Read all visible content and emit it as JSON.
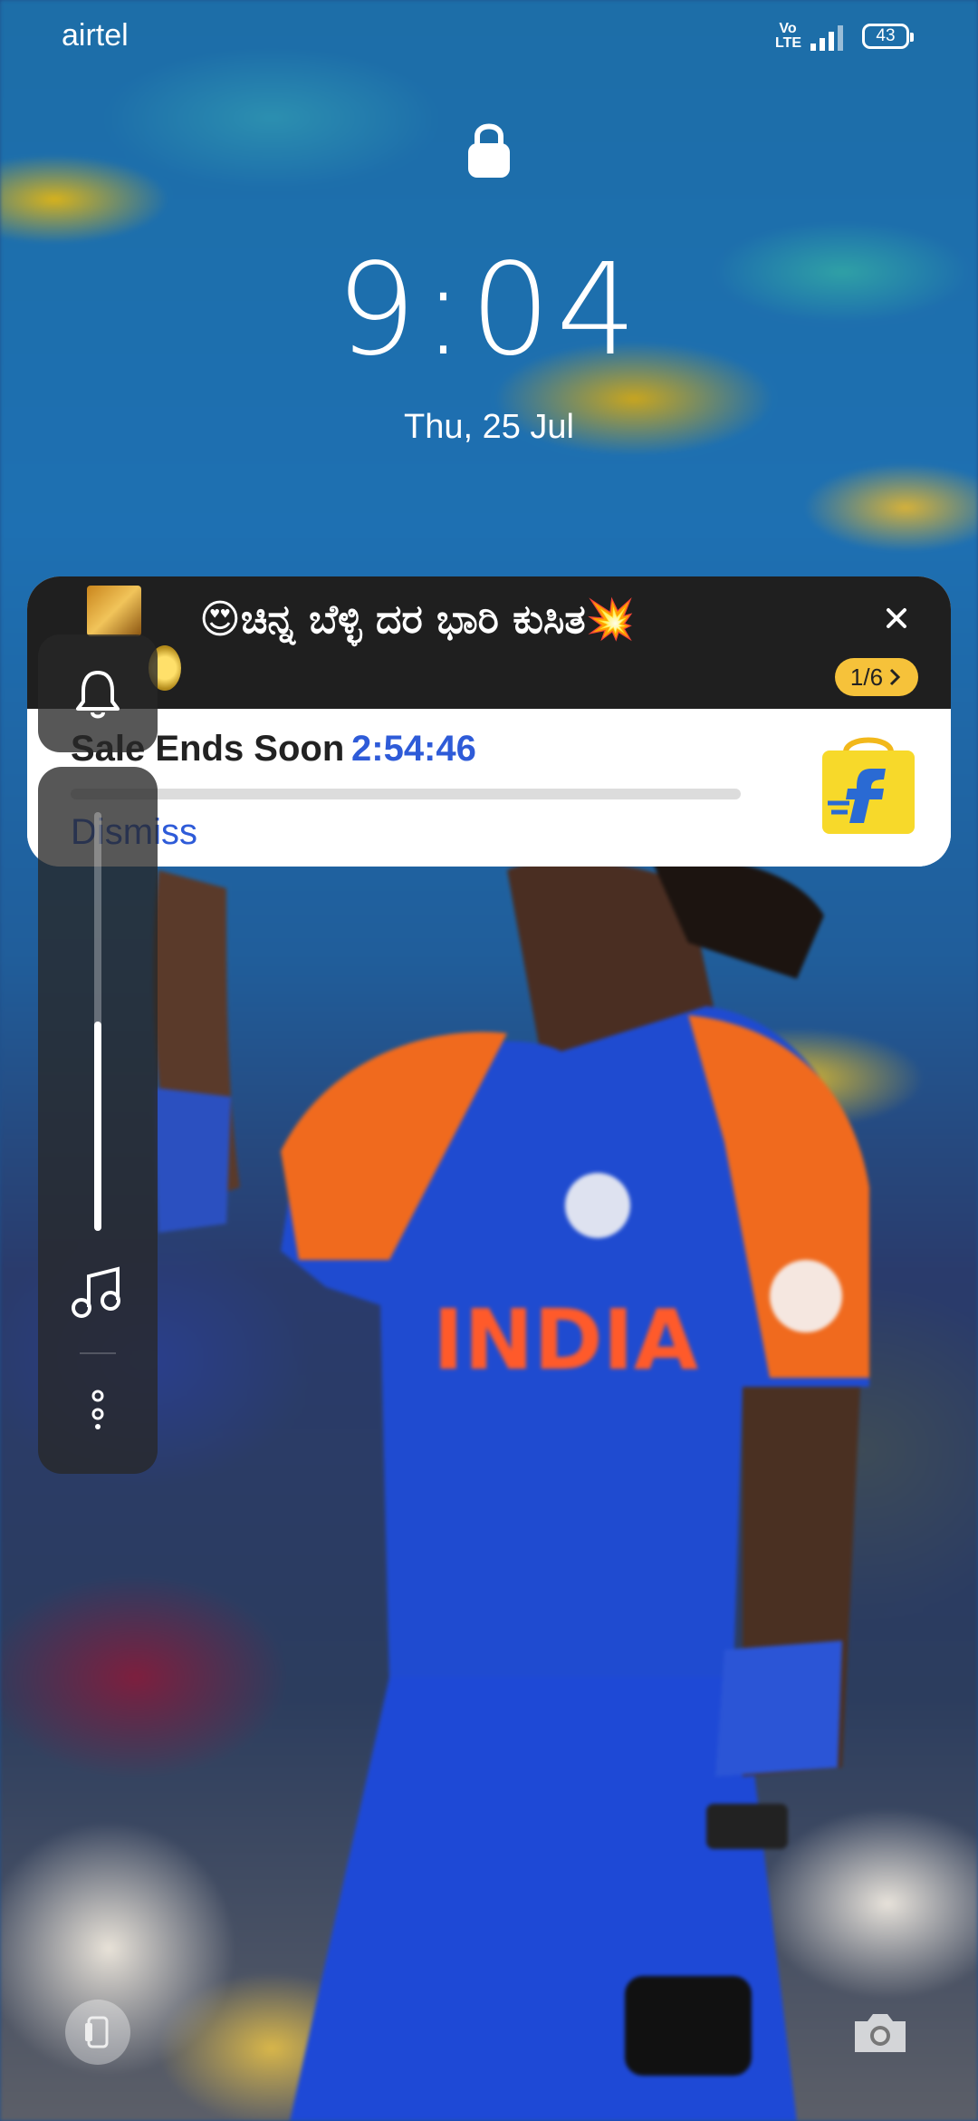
{
  "status_bar": {
    "carrier": "airtel",
    "volte_line1": "Vo",
    "volte_line2": "LTE",
    "battery": "43"
  },
  "lock": {
    "time": "9:04",
    "date": "Thu, 25 Jul"
  },
  "notification": {
    "title": "😍ಚಿನ್ನ ಬೆಳ್ಳಿ ದರ ಭಾರಿ ಕುಸಿತ💥",
    "counter": "1/6",
    "sale_label": "Sale Ends Soon",
    "countdown": "2:54:46",
    "dismiss_label": "Dismiss",
    "progress": 0.0,
    "accent_color": "#2e5bd8"
  },
  "edge_panel": {
    "icons": [
      "bell-icon",
      "music-note-icon",
      "more-options-icon"
    ],
    "volume_level": 0.5
  },
  "bottom": {
    "left_icon": "phone-icon",
    "right_icon": "camera-icon"
  },
  "wallpaper": {
    "jersey_text": "INDIA"
  }
}
